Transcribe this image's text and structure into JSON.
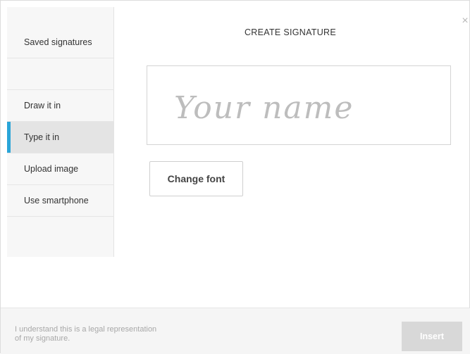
{
  "dialog": {
    "title": "CREATE SIGNATURE",
    "close_symbol": "×"
  },
  "sidebar": {
    "items": [
      {
        "label": "Saved signatures",
        "active": false
      },
      {
        "label": "Draw it in",
        "active": false
      },
      {
        "label": "Type it in",
        "active": true
      },
      {
        "label": "Upload image",
        "active": false
      },
      {
        "label": "Use smartphone",
        "active": false
      }
    ]
  },
  "signature": {
    "placeholder": "Your name",
    "value": ""
  },
  "buttons": {
    "change_font": "Change font",
    "insert": "Insert"
  },
  "footer": {
    "legal_line1": "I understand this is a legal representation",
    "legal_line2": "of my signature."
  },
  "colors": {
    "accent": "#2aa5d8",
    "insert_disabled": "#d8d8d8"
  }
}
